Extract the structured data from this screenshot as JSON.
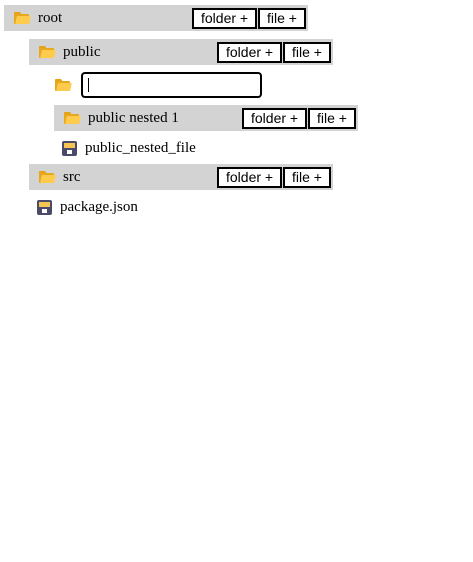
{
  "tree": {
    "root": {
      "name": "root",
      "icon": "folder-icon",
      "add_folder_label": "folder +",
      "add_file_label": "file +"
    },
    "public": {
      "name": "public",
      "icon": "folder-icon",
      "add_folder_label": "folder +",
      "add_file_label": "file +"
    },
    "new_item_input": {
      "icon": "folder-icon",
      "value": ""
    },
    "public_nested_1": {
      "name": "public nested 1",
      "icon": "folder-icon",
      "add_folder_label": "folder +",
      "add_file_label": "file +"
    },
    "public_nested_file": {
      "name": "public_nested_file",
      "icon": "floppy-disk-icon"
    },
    "src": {
      "name": "src",
      "icon": "folder-icon",
      "add_folder_label": "folder +",
      "add_file_label": "file +"
    },
    "package_json": {
      "name": "package.json",
      "icon": "floppy-disk-icon"
    }
  },
  "colors": {
    "folder_row_bg": "#d3d3d3",
    "folder_icon": "#ffcb4c",
    "file_icon": "#4a4a6a"
  }
}
